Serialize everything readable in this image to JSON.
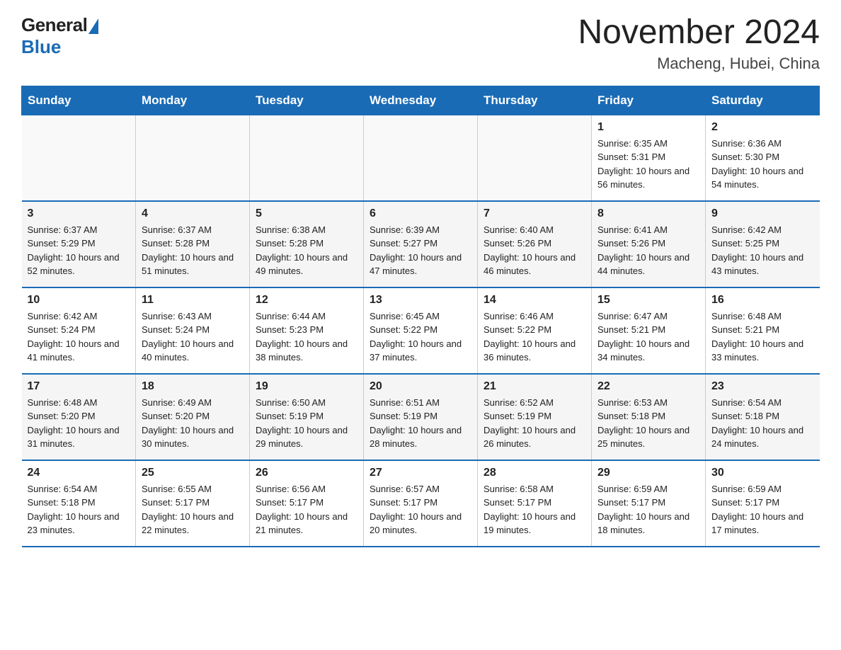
{
  "logo": {
    "general": "General",
    "blue": "Blue"
  },
  "title": "November 2024",
  "subtitle": "Macheng, Hubei, China",
  "days_of_week": [
    "Sunday",
    "Monday",
    "Tuesday",
    "Wednesday",
    "Thursday",
    "Friday",
    "Saturday"
  ],
  "weeks": [
    [
      {
        "day": "",
        "info": ""
      },
      {
        "day": "",
        "info": ""
      },
      {
        "day": "",
        "info": ""
      },
      {
        "day": "",
        "info": ""
      },
      {
        "day": "",
        "info": ""
      },
      {
        "day": "1",
        "info": "Sunrise: 6:35 AM\nSunset: 5:31 PM\nDaylight: 10 hours and 56 minutes."
      },
      {
        "day": "2",
        "info": "Sunrise: 6:36 AM\nSunset: 5:30 PM\nDaylight: 10 hours and 54 minutes."
      }
    ],
    [
      {
        "day": "3",
        "info": "Sunrise: 6:37 AM\nSunset: 5:29 PM\nDaylight: 10 hours and 52 minutes."
      },
      {
        "day": "4",
        "info": "Sunrise: 6:37 AM\nSunset: 5:28 PM\nDaylight: 10 hours and 51 minutes."
      },
      {
        "day": "5",
        "info": "Sunrise: 6:38 AM\nSunset: 5:28 PM\nDaylight: 10 hours and 49 minutes."
      },
      {
        "day": "6",
        "info": "Sunrise: 6:39 AM\nSunset: 5:27 PM\nDaylight: 10 hours and 47 minutes."
      },
      {
        "day": "7",
        "info": "Sunrise: 6:40 AM\nSunset: 5:26 PM\nDaylight: 10 hours and 46 minutes."
      },
      {
        "day": "8",
        "info": "Sunrise: 6:41 AM\nSunset: 5:26 PM\nDaylight: 10 hours and 44 minutes."
      },
      {
        "day": "9",
        "info": "Sunrise: 6:42 AM\nSunset: 5:25 PM\nDaylight: 10 hours and 43 minutes."
      }
    ],
    [
      {
        "day": "10",
        "info": "Sunrise: 6:42 AM\nSunset: 5:24 PM\nDaylight: 10 hours and 41 minutes."
      },
      {
        "day": "11",
        "info": "Sunrise: 6:43 AM\nSunset: 5:24 PM\nDaylight: 10 hours and 40 minutes."
      },
      {
        "day": "12",
        "info": "Sunrise: 6:44 AM\nSunset: 5:23 PM\nDaylight: 10 hours and 38 minutes."
      },
      {
        "day": "13",
        "info": "Sunrise: 6:45 AM\nSunset: 5:22 PM\nDaylight: 10 hours and 37 minutes."
      },
      {
        "day": "14",
        "info": "Sunrise: 6:46 AM\nSunset: 5:22 PM\nDaylight: 10 hours and 36 minutes."
      },
      {
        "day": "15",
        "info": "Sunrise: 6:47 AM\nSunset: 5:21 PM\nDaylight: 10 hours and 34 minutes."
      },
      {
        "day": "16",
        "info": "Sunrise: 6:48 AM\nSunset: 5:21 PM\nDaylight: 10 hours and 33 minutes."
      }
    ],
    [
      {
        "day": "17",
        "info": "Sunrise: 6:48 AM\nSunset: 5:20 PM\nDaylight: 10 hours and 31 minutes."
      },
      {
        "day": "18",
        "info": "Sunrise: 6:49 AM\nSunset: 5:20 PM\nDaylight: 10 hours and 30 minutes."
      },
      {
        "day": "19",
        "info": "Sunrise: 6:50 AM\nSunset: 5:19 PM\nDaylight: 10 hours and 29 minutes."
      },
      {
        "day": "20",
        "info": "Sunrise: 6:51 AM\nSunset: 5:19 PM\nDaylight: 10 hours and 28 minutes."
      },
      {
        "day": "21",
        "info": "Sunrise: 6:52 AM\nSunset: 5:19 PM\nDaylight: 10 hours and 26 minutes."
      },
      {
        "day": "22",
        "info": "Sunrise: 6:53 AM\nSunset: 5:18 PM\nDaylight: 10 hours and 25 minutes."
      },
      {
        "day": "23",
        "info": "Sunrise: 6:54 AM\nSunset: 5:18 PM\nDaylight: 10 hours and 24 minutes."
      }
    ],
    [
      {
        "day": "24",
        "info": "Sunrise: 6:54 AM\nSunset: 5:18 PM\nDaylight: 10 hours and 23 minutes."
      },
      {
        "day": "25",
        "info": "Sunrise: 6:55 AM\nSunset: 5:17 PM\nDaylight: 10 hours and 22 minutes."
      },
      {
        "day": "26",
        "info": "Sunrise: 6:56 AM\nSunset: 5:17 PM\nDaylight: 10 hours and 21 minutes."
      },
      {
        "day": "27",
        "info": "Sunrise: 6:57 AM\nSunset: 5:17 PM\nDaylight: 10 hours and 20 minutes."
      },
      {
        "day": "28",
        "info": "Sunrise: 6:58 AM\nSunset: 5:17 PM\nDaylight: 10 hours and 19 minutes."
      },
      {
        "day": "29",
        "info": "Sunrise: 6:59 AM\nSunset: 5:17 PM\nDaylight: 10 hours and 18 minutes."
      },
      {
        "day": "30",
        "info": "Sunrise: 6:59 AM\nSunset: 5:17 PM\nDaylight: 10 hours and 17 minutes."
      }
    ]
  ]
}
